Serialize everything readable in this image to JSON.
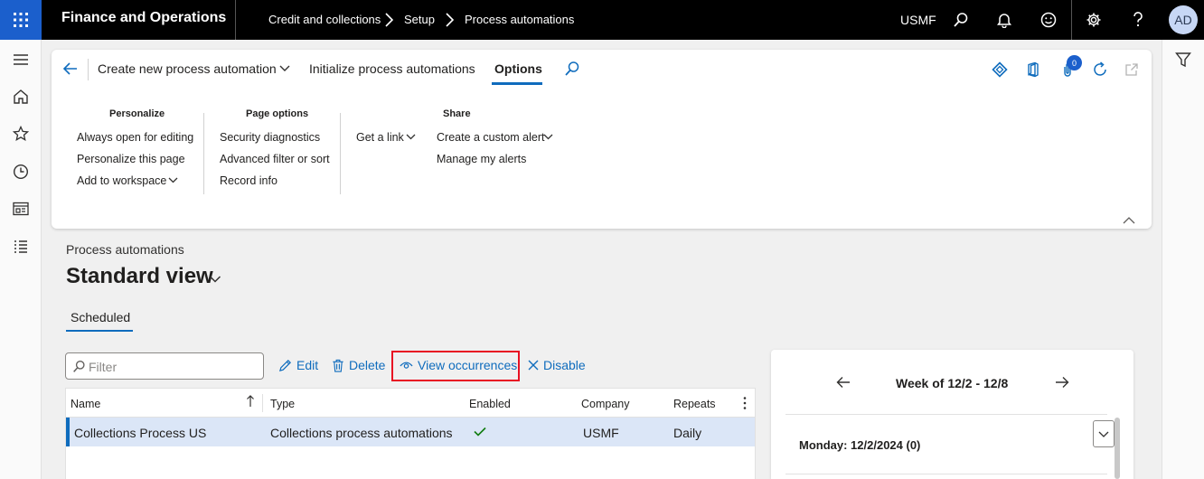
{
  "topbar": {
    "app_title": "Finance and Operations",
    "breadcrumbs": [
      "Credit and collections",
      "Setup",
      "Process automations"
    ],
    "company": "USMF",
    "avatar_initials": "AD"
  },
  "actionpane": {
    "create_new": "Create new process automation",
    "initialize": "Initialize process automations",
    "options_tab": "Options",
    "notification_count": "0",
    "groups": {
      "personalize": {
        "title": "Personalize",
        "items": [
          "Always open for editing",
          "Personalize this page",
          "Add to workspace"
        ]
      },
      "page_options": {
        "title": "Page options",
        "items": [
          "Security diagnostics",
          "Advanced filter or sort",
          "Record info"
        ]
      },
      "share": {
        "title": "Share",
        "get_link": "Get a link",
        "items": [
          "Create a custom alert",
          "Manage my alerts"
        ]
      }
    }
  },
  "page": {
    "caption": "Process automations",
    "view_title": "Standard view",
    "tab": "Scheduled"
  },
  "toolbar": {
    "filter_placeholder": "Filter",
    "edit": "Edit",
    "delete": "Delete",
    "view_occurrences": "View occurrences",
    "disable": "Disable"
  },
  "grid": {
    "columns": [
      "Name",
      "Type",
      "Enabled",
      "Company",
      "Repeats"
    ],
    "rows": [
      {
        "name": "Collections Process US",
        "type": "Collections process automations",
        "enabled": true,
        "company": "USMF",
        "repeats": "Daily"
      }
    ]
  },
  "calendar": {
    "week_label": "Week of 12/2 - 12/8",
    "day_label": "Monday: 12/2/2024 (0)"
  },
  "colors": {
    "accent": "#0f6cbd",
    "waffle_bg": "#1b5fcc",
    "highlight": "#e81123",
    "selected_row": "#dbe6f7"
  }
}
